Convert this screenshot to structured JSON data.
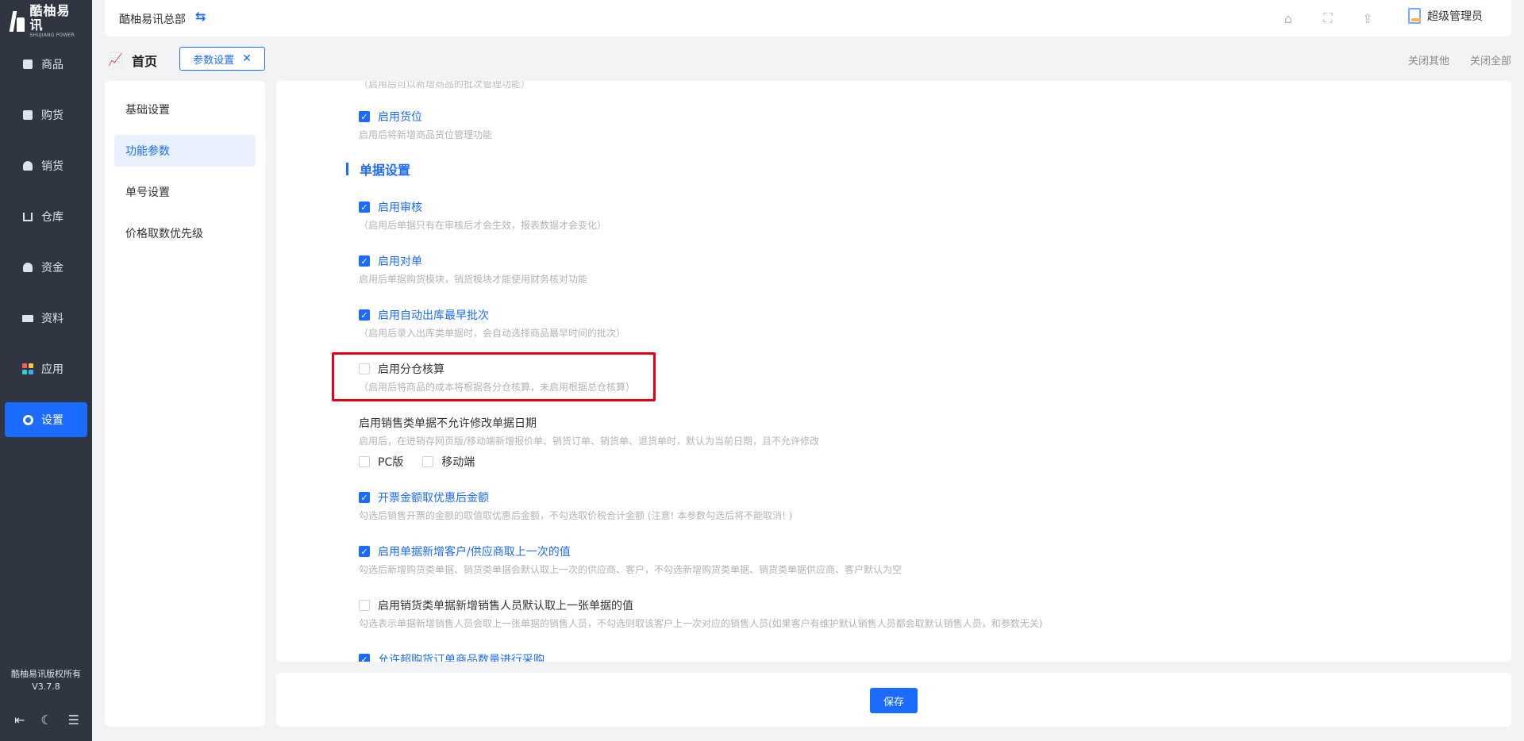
{
  "brand": {
    "title": "酷柚易讯",
    "subtitle": "SHUJIANG POWER"
  },
  "nav": [
    {
      "label": "商品",
      "icon": "box-icon"
    },
    {
      "label": "购货",
      "icon": "purchase-icon"
    },
    {
      "label": "销货",
      "icon": "sales-icon"
    },
    {
      "label": "仓库",
      "icon": "warehouse-icon"
    },
    {
      "label": "资金",
      "icon": "money-bag-icon"
    },
    {
      "label": "资料",
      "icon": "truck-icon"
    },
    {
      "label": "应用",
      "icon": "apps-icon"
    },
    {
      "label": "设置",
      "icon": "gear-icon",
      "active": true
    }
  ],
  "sidebar_footer": {
    "copyright": "酷柚易讯版权所有",
    "version": "V3.7.8"
  },
  "topbar": {
    "company": "酷柚易讯总部",
    "user": "超级管理员"
  },
  "tabs": {
    "home": "首页",
    "current": "参数设置",
    "close_others": "关闭其他",
    "close_all": "关闭全部"
  },
  "submenu": [
    {
      "label": "基础设置"
    },
    {
      "label": "功能参数",
      "active": true
    },
    {
      "label": "单号设置"
    },
    {
      "label": "价格取数优先级"
    }
  ],
  "settings": {
    "top_cut_text": "（启用后可以新增商品的批次管理功能）",
    "location": {
      "label": "启用货位",
      "desc": "启用后将新增商品货位管理功能",
      "checked": true
    },
    "section_title": "单据设置",
    "audit": {
      "label": "启用审核",
      "desc": "（启用后单据只有在审核后才会生效，报表数据才会变化）",
      "checked": true
    },
    "reconcile": {
      "label": "启用对单",
      "desc": "启用后单据购货模块，销货模块才能使用财务核对功能",
      "checked": true
    },
    "auto_batch": {
      "label": "启用自动出库最早批次",
      "desc": "（启用后录入出库类单据时，会自动选择商品最早时间的批次）",
      "checked": true
    },
    "sub_warehouse": {
      "label": "启用分仓核算",
      "desc": "（启用后将商品的成本将根据各分仓核算，未启用根据总仓核算）",
      "checked": false
    },
    "no_edit_date": {
      "label": "启用销售类单据不允许修改单据日期",
      "desc": "启用后，在进销存网页版/移动端新增报价单、销货订单、销货单、退货单时，默认为当前日期，且不允许修改",
      "pc_label": "PC版",
      "mobile_label": "移动端"
    },
    "invoice": {
      "label": "开票金额取优惠后金额",
      "desc": "勾选后销售开票的金额的取值取优惠后金额，不勾选取价税合计金额 (注意! 本参数勾选后将不能取消! )",
      "checked": true
    },
    "last_value": {
      "label": "启用单据新增客户/供应商取上一次的值",
      "desc": "勾选后新增购货类单据、销货类单据会默认取上一次的供应商、客户，不勾选新增购货类单据、销货类单据供应商、客户默认为空",
      "checked": true
    },
    "salesperson": {
      "label": "启用销货类单据新增销售人员默认取上一张单据的值",
      "desc": "勾选表示单据新增销售人员会取上一张单据的销售人员，不勾选则取该客户上一次对应的销售人员(如果客户有维护默认销售人员都会取默认销售人员，和参数无关)",
      "checked": false
    },
    "purchase_qty": {
      "label": "允许超购货订单商品数量进行采购",
      "checked": true
    }
  },
  "footer": {
    "save_label": "保存"
  },
  "colors": {
    "accent": "#1b6bff",
    "sidebar": "#2f3541",
    "highlight": "#e60012"
  }
}
